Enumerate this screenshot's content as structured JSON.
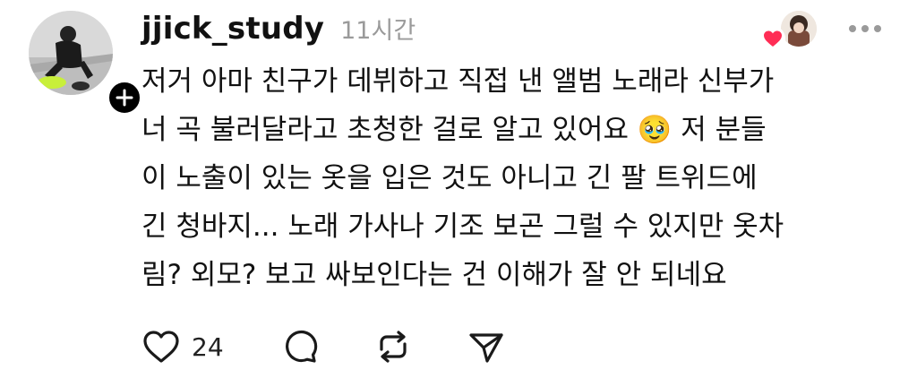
{
  "post": {
    "username": "jjick_study",
    "timestamp": "11시간",
    "body": "저거 아마 친구가 데뷔하고 직접 낸 앨범 노래라 신부가\n너 곡 불러달라고 초청한 걸로 알고 있어요 🥹 저 분들\n이 노출이 있는 옷을 입은 것도 아니고 긴 팔 트위드에\n긴 청바지... 노래 가사나 기조 보곤 그럴 수 있지만 옷차\n림? 외모? 보고 싸보인다는 건 이해가 잘 안 되네요",
    "like_count": "24"
  },
  "icons": {
    "follow": "plus-icon",
    "reaction": "heart-icon",
    "more": "more-horizontal-icon",
    "like": "heart-outline-icon",
    "reply": "comment-bubble-icon",
    "repost": "repost-icon",
    "share": "send-icon"
  },
  "colors": {
    "heart": "#ff2d55",
    "timestamp": "#9a9a9a",
    "text": "#111111"
  }
}
